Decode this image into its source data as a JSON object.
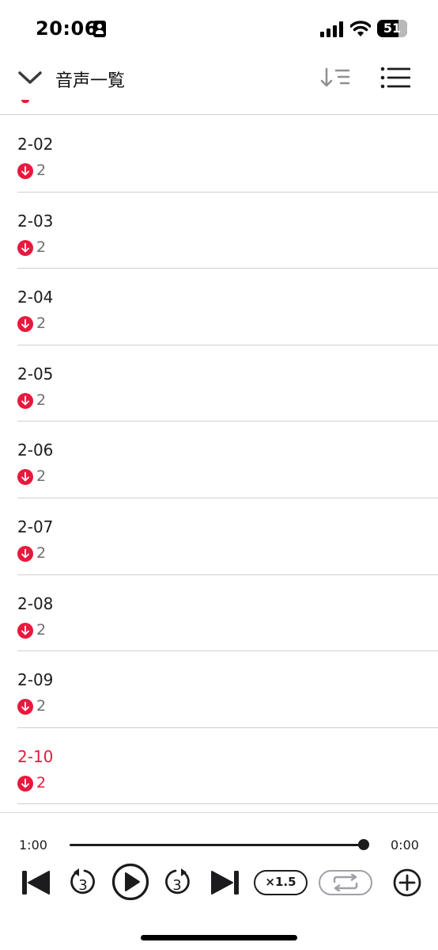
{
  "status_bar": {
    "time": "20:06",
    "battery_level": "51",
    "icons": [
      "id-card-icon",
      "signal-icon",
      "wifi-icon",
      "battery-icon"
    ]
  },
  "header": {
    "title": "音声一覧",
    "icons": [
      "chevron-down-icon",
      "sort-icon",
      "list-icon"
    ]
  },
  "tracks": [
    {
      "title": "2-02",
      "count": "2",
      "active": false
    },
    {
      "title": "2-03",
      "count": "2",
      "active": false
    },
    {
      "title": "2-04",
      "count": "2",
      "active": false
    },
    {
      "title": "2-05",
      "count": "2",
      "active": false
    },
    {
      "title": "2-06",
      "count": "2",
      "active": false
    },
    {
      "title": "2-07",
      "count": "2",
      "active": false
    },
    {
      "title": "2-08",
      "count": "2",
      "active": false
    },
    {
      "title": "2-09",
      "count": "2",
      "active": false
    },
    {
      "title": "2-10",
      "count": "2",
      "active": true
    }
  ],
  "player": {
    "elapsed": "1:00",
    "remaining": "0:00",
    "progress_fraction": 1.0,
    "rewind_seconds": "3",
    "forward_seconds": "3",
    "speed_label": "×1.5",
    "icons": [
      "skip-previous-icon",
      "rewind-icon",
      "play-icon",
      "forward-icon",
      "skip-next-icon",
      "repeat-icon",
      "add-icon"
    ]
  },
  "colors": {
    "accent": "#e8193c",
    "text": "#1c1c1e",
    "secondary_text": "#6e6e73",
    "divider": "#cfcfd4"
  }
}
